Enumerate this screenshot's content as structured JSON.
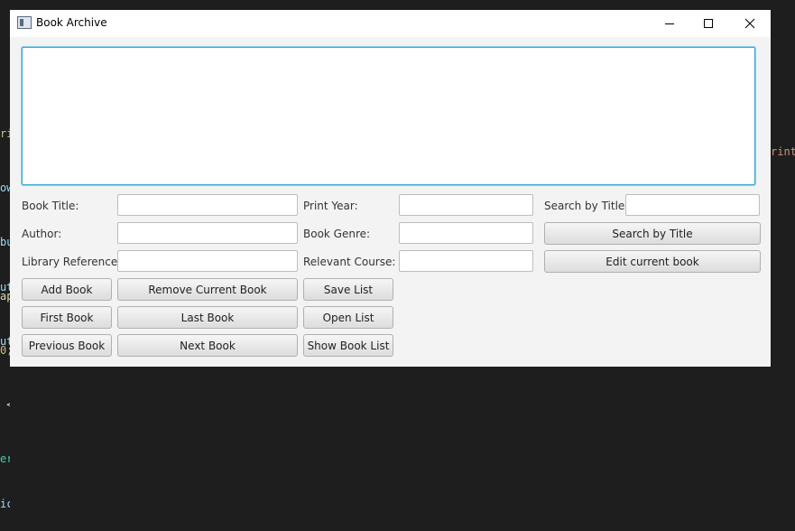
{
  "window": {
    "title": "Book Archive",
    "minimize_symbol": "–",
    "maximize_symbol": "□",
    "close_symbol": "✕",
    "icon": "app-window-icon"
  },
  "background_code": {
    "left_lines": [
      "ri",
      "ow",
      "bu",
      "ap",
      "0;",
      " <",
      "er"
    ],
    "bottom_lines": [
      "ut",
      "ut",
      "",
      "",
      "ic"
    ],
    "right_fragment": "rint"
  },
  "form": {
    "output_area_value": "",
    "labels": {
      "book_title": "Book Title:",
      "author": "Author:",
      "library_reference": "Library Reference:",
      "print_year": "Print Year:",
      "book_genre": "Book Genre:",
      "relevant_course": "Relevant Course:",
      "search_by_title": "Search by Title:"
    },
    "values": {
      "book_title": "",
      "author": "",
      "library_reference": "",
      "print_year": "",
      "book_genre": "",
      "relevant_course": "",
      "search_title": ""
    },
    "buttons": {
      "search_by_title": "Search by Title",
      "edit_current_book": "Edit current book",
      "add_book": "Add Book",
      "remove_current_book": "Remove Current Book",
      "save_list": "Save List",
      "first_book": "First Book",
      "last_book": "Last Book",
      "open_list": "Open List",
      "previous_book": "Previous Book",
      "next_book": "Next Book",
      "show_book_list": "Show Book List"
    }
  }
}
